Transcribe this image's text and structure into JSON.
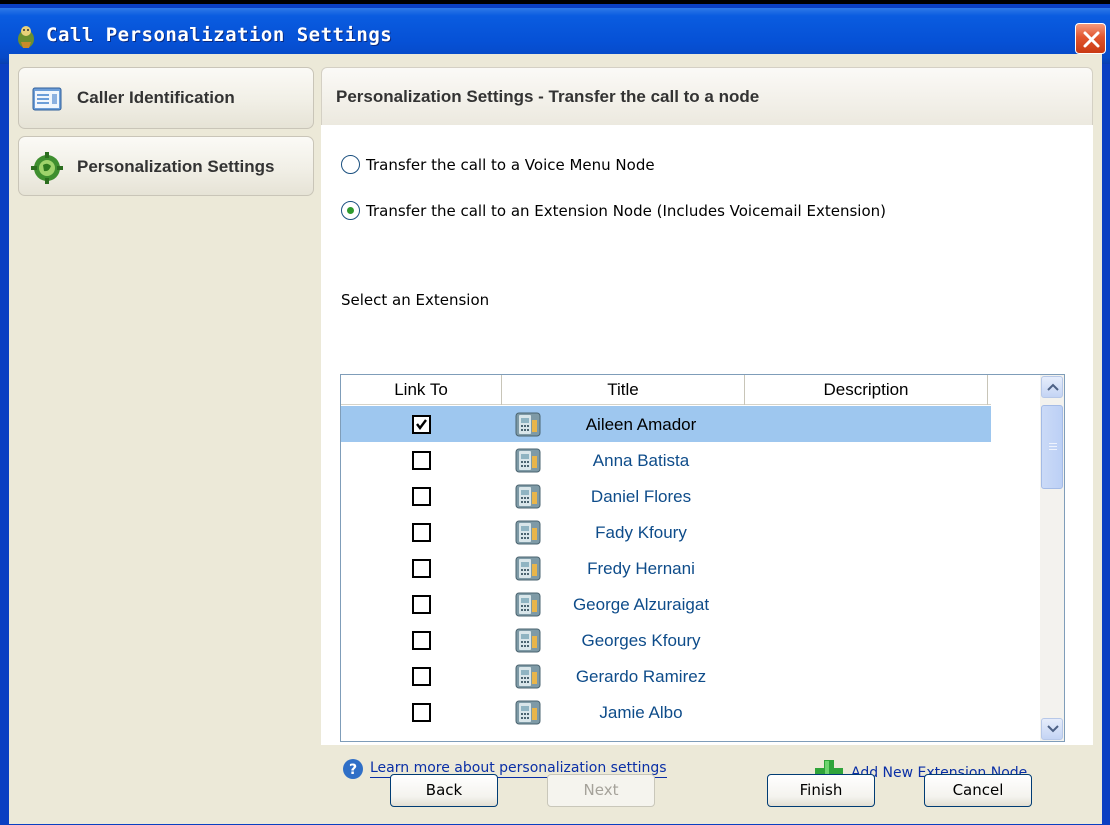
{
  "window": {
    "title": "Call Personalization Settings"
  },
  "nav": {
    "items": [
      {
        "label": "Caller Identification",
        "icon": "id-card-icon"
      },
      {
        "label": "Personalization Settings",
        "icon": "gear-globe-icon"
      }
    ]
  },
  "panel": {
    "title": "Personalization Settings - Transfer the call to a node",
    "options": [
      {
        "label": "Transfer the call to a Voice Menu Node",
        "selected": false
      },
      {
        "label": "Transfer the call to an Extension Node (Includes Voicemail Extension)",
        "selected": true
      }
    ],
    "select_label": "Select an Extension"
  },
  "list": {
    "columns": [
      "Link To",
      "Title",
      "Description"
    ],
    "rows": [
      {
        "checked": true,
        "title": "Aileen Amador",
        "description": "",
        "selected": true
      },
      {
        "checked": false,
        "title": "Anna Batista",
        "description": ""
      },
      {
        "checked": false,
        "title": "Daniel Flores",
        "description": ""
      },
      {
        "checked": false,
        "title": "Fady Kfoury",
        "description": ""
      },
      {
        "checked": false,
        "title": "Fredy Hernani",
        "description": ""
      },
      {
        "checked": false,
        "title": "George Alzuraigat",
        "description": ""
      },
      {
        "checked": false,
        "title": "Georges Kfoury",
        "description": ""
      },
      {
        "checked": false,
        "title": "Gerardo Ramirez",
        "description": ""
      },
      {
        "checked": false,
        "title": "Jamie Albo",
        "description": ""
      }
    ]
  },
  "links": {
    "learn_more": "Learn more about personalization settings",
    "add_node": "Add New Extension Node"
  },
  "buttons": {
    "back": "Back",
    "next": "Next",
    "finish": "Finish",
    "cancel": "Cancel"
  },
  "colors": {
    "title_bar": "#0651d6",
    "selected_row": "#9ec7ef",
    "link": "#0a2fa6",
    "row_text": "#0e4c8a"
  }
}
